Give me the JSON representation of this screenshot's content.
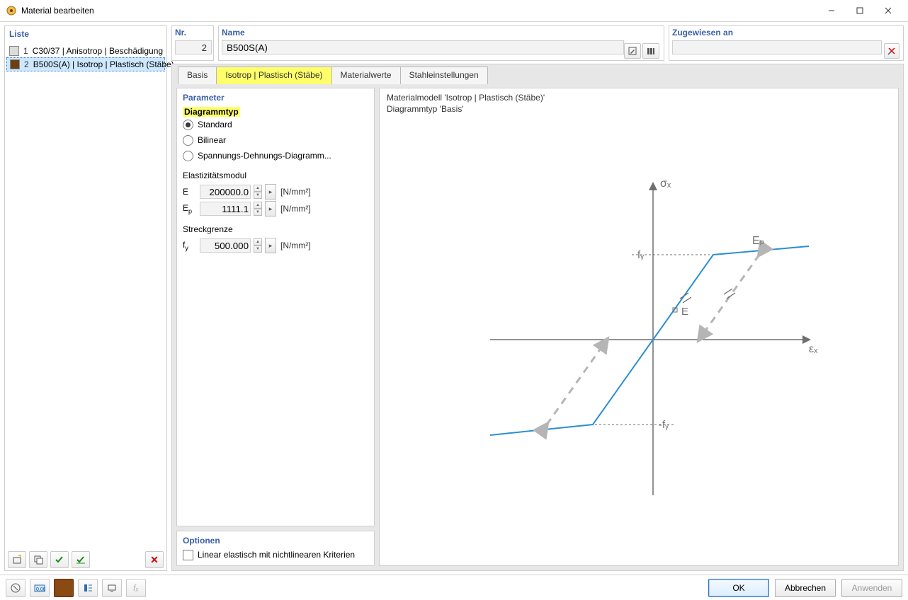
{
  "window": {
    "title": "Material bearbeiten"
  },
  "left": {
    "title": "Liste",
    "items": [
      {
        "n": "1",
        "label": "C30/37 | Anisotrop | Beschädigung",
        "swatch": "#dcdcdc"
      },
      {
        "n": "2",
        "label": "B500S(A) | Isotrop | Plastisch (Stäbe)",
        "swatch": "#6b3e14"
      }
    ]
  },
  "header": {
    "nr_label": "Nr.",
    "nr_value": "2",
    "name_label": "Name",
    "name_value": "B500S(A)",
    "assigned_label": "Zugewiesen an"
  },
  "tabs": {
    "items": [
      "Basis",
      "Isotrop | Plastisch (Stäbe)",
      "Materialwerte",
      "Stahleinstellungen"
    ],
    "active_index": 1
  },
  "parameter": {
    "title": "Parameter",
    "diagtype_label": "Diagrammtyp",
    "radio": {
      "opt1": "Standard",
      "opt2": "Bilinear",
      "opt3": "Spannungs-Dehnungs-Diagramm..."
    },
    "emod_label": "Elastizitätsmodul",
    "e_sym": "E",
    "e_val": "200000.0",
    "ep_sym": "E",
    "ep_sym_sub": "p",
    "ep_val": "1111.1",
    "unit_stress": "[N/mm²]",
    "yield_label": "Streckgrenze",
    "fy_sym": "f",
    "fy_sym_sub": "y",
    "fy_val": "500.000"
  },
  "options": {
    "title": "Optionen",
    "chk1": "Linear elastisch mit nichtlinearen Kriterien"
  },
  "diagram": {
    "line1": "Materialmodell 'Isotrop | Plastisch (Stäbe)'",
    "line2": "Diagrammtyp 'Basis'",
    "labels": {
      "sigmax": "σₓ",
      "epsx": "εₓ",
      "fy": "fᵧ",
      "neg_fy": "-fᵧ",
      "E": "E",
      "Ep": "Eₚ"
    }
  },
  "buttons": {
    "ok": "OK",
    "cancel": "Abbrechen",
    "apply": "Anwenden"
  },
  "chart_data": {
    "type": "line",
    "description": "Bilinear elastic-plastic stress-strain (σ-ε) curve with hardening slope Ep and yield stress fy (plus dashed unloading path).",
    "xlabel": "εₓ",
    "ylabel": "σₓ",
    "annotations": [
      "fᵧ",
      "-fᵧ",
      "E",
      "Eₚ"
    ],
    "E": 200000.0,
    "Ep": 1111.1,
    "fy": 500.0,
    "series": [
      {
        "name": "stress-strain",
        "x_rel": [
          -1.0,
          -0.35,
          0.35,
          1.0
        ],
        "y_rel": [
          -1.08,
          -1.0,
          1.0,
          1.08
        ]
      },
      {
        "name": "unload-dashed",
        "x_rel": [
          -0.95,
          -0.25,
          0.25,
          0.95
        ],
        "y_rel": [
          -1.0,
          0.0,
          0.0,
          1.0
        ]
      }
    ]
  }
}
